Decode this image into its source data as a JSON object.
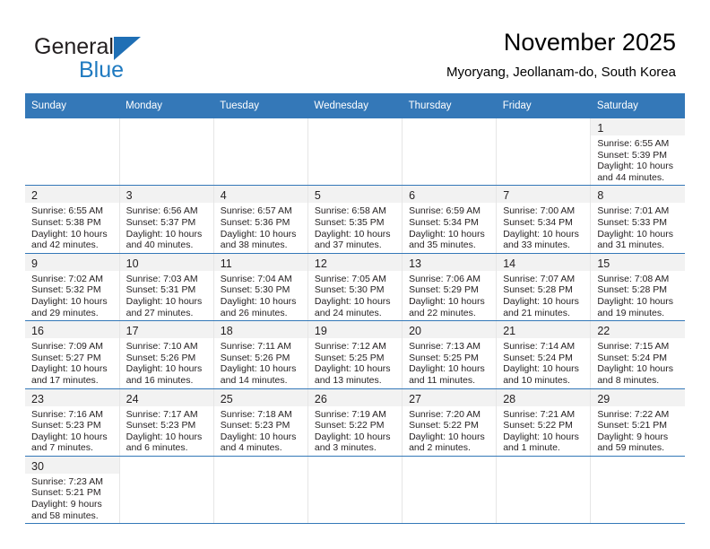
{
  "brand": {
    "name_part1": "General",
    "name_part2": "Blue",
    "triangle_color": "#1f6fb5",
    "blue_color": "#1f7ac0"
  },
  "header": {
    "title": "November 2025",
    "subtitle": "Myoryang, Jeollanam-do, South Korea"
  },
  "theme": {
    "header_row_bg": "#3478b8",
    "daynum_band_bg": "#f2f2f2",
    "row_divider": "#3478b8",
    "cell_divider": "#e6e6e6"
  },
  "weekdays": [
    "Sunday",
    "Monday",
    "Tuesday",
    "Wednesday",
    "Thursday",
    "Friday",
    "Saturday"
  ],
  "weeks": [
    [
      {
        "blank": true
      },
      {
        "blank": true
      },
      {
        "blank": true
      },
      {
        "blank": true
      },
      {
        "blank": true
      },
      {
        "blank": true
      },
      {
        "day": "1",
        "sunrise": "Sunrise: 6:55 AM",
        "sunset": "Sunset: 5:39 PM",
        "daylight1": "Daylight: 10 hours",
        "daylight2": "and 44 minutes."
      }
    ],
    [
      {
        "day": "2",
        "sunrise": "Sunrise: 6:55 AM",
        "sunset": "Sunset: 5:38 PM",
        "daylight1": "Daylight: 10 hours",
        "daylight2": "and 42 minutes."
      },
      {
        "day": "3",
        "sunrise": "Sunrise: 6:56 AM",
        "sunset": "Sunset: 5:37 PM",
        "daylight1": "Daylight: 10 hours",
        "daylight2": "and 40 minutes."
      },
      {
        "day": "4",
        "sunrise": "Sunrise: 6:57 AM",
        "sunset": "Sunset: 5:36 PM",
        "daylight1": "Daylight: 10 hours",
        "daylight2": "and 38 minutes."
      },
      {
        "day": "5",
        "sunrise": "Sunrise: 6:58 AM",
        "sunset": "Sunset: 5:35 PM",
        "daylight1": "Daylight: 10 hours",
        "daylight2": "and 37 minutes."
      },
      {
        "day": "6",
        "sunrise": "Sunrise: 6:59 AM",
        "sunset": "Sunset: 5:34 PM",
        "daylight1": "Daylight: 10 hours",
        "daylight2": "and 35 minutes."
      },
      {
        "day": "7",
        "sunrise": "Sunrise: 7:00 AM",
        "sunset": "Sunset: 5:34 PM",
        "daylight1": "Daylight: 10 hours",
        "daylight2": "and 33 minutes."
      },
      {
        "day": "8",
        "sunrise": "Sunrise: 7:01 AM",
        "sunset": "Sunset: 5:33 PM",
        "daylight1": "Daylight: 10 hours",
        "daylight2": "and 31 minutes."
      }
    ],
    [
      {
        "day": "9",
        "sunrise": "Sunrise: 7:02 AM",
        "sunset": "Sunset: 5:32 PM",
        "daylight1": "Daylight: 10 hours",
        "daylight2": "and 29 minutes."
      },
      {
        "day": "10",
        "sunrise": "Sunrise: 7:03 AM",
        "sunset": "Sunset: 5:31 PM",
        "daylight1": "Daylight: 10 hours",
        "daylight2": "and 27 minutes."
      },
      {
        "day": "11",
        "sunrise": "Sunrise: 7:04 AM",
        "sunset": "Sunset: 5:30 PM",
        "daylight1": "Daylight: 10 hours",
        "daylight2": "and 26 minutes."
      },
      {
        "day": "12",
        "sunrise": "Sunrise: 7:05 AM",
        "sunset": "Sunset: 5:30 PM",
        "daylight1": "Daylight: 10 hours",
        "daylight2": "and 24 minutes."
      },
      {
        "day": "13",
        "sunrise": "Sunrise: 7:06 AM",
        "sunset": "Sunset: 5:29 PM",
        "daylight1": "Daylight: 10 hours",
        "daylight2": "and 22 minutes."
      },
      {
        "day": "14",
        "sunrise": "Sunrise: 7:07 AM",
        "sunset": "Sunset: 5:28 PM",
        "daylight1": "Daylight: 10 hours",
        "daylight2": "and 21 minutes."
      },
      {
        "day": "15",
        "sunrise": "Sunrise: 7:08 AM",
        "sunset": "Sunset: 5:28 PM",
        "daylight1": "Daylight: 10 hours",
        "daylight2": "and 19 minutes."
      }
    ],
    [
      {
        "day": "16",
        "sunrise": "Sunrise: 7:09 AM",
        "sunset": "Sunset: 5:27 PM",
        "daylight1": "Daylight: 10 hours",
        "daylight2": "and 17 minutes."
      },
      {
        "day": "17",
        "sunrise": "Sunrise: 7:10 AM",
        "sunset": "Sunset: 5:26 PM",
        "daylight1": "Daylight: 10 hours",
        "daylight2": "and 16 minutes."
      },
      {
        "day": "18",
        "sunrise": "Sunrise: 7:11 AM",
        "sunset": "Sunset: 5:26 PM",
        "daylight1": "Daylight: 10 hours",
        "daylight2": "and 14 minutes."
      },
      {
        "day": "19",
        "sunrise": "Sunrise: 7:12 AM",
        "sunset": "Sunset: 5:25 PM",
        "daylight1": "Daylight: 10 hours",
        "daylight2": "and 13 minutes."
      },
      {
        "day": "20",
        "sunrise": "Sunrise: 7:13 AM",
        "sunset": "Sunset: 5:25 PM",
        "daylight1": "Daylight: 10 hours",
        "daylight2": "and 11 minutes."
      },
      {
        "day": "21",
        "sunrise": "Sunrise: 7:14 AM",
        "sunset": "Sunset: 5:24 PM",
        "daylight1": "Daylight: 10 hours",
        "daylight2": "and 10 minutes."
      },
      {
        "day": "22",
        "sunrise": "Sunrise: 7:15 AM",
        "sunset": "Sunset: 5:24 PM",
        "daylight1": "Daylight: 10 hours",
        "daylight2": "and 8 minutes."
      }
    ],
    [
      {
        "day": "23",
        "sunrise": "Sunrise: 7:16 AM",
        "sunset": "Sunset: 5:23 PM",
        "daylight1": "Daylight: 10 hours",
        "daylight2": "and 7 minutes."
      },
      {
        "day": "24",
        "sunrise": "Sunrise: 7:17 AM",
        "sunset": "Sunset: 5:23 PM",
        "daylight1": "Daylight: 10 hours",
        "daylight2": "and 6 minutes."
      },
      {
        "day": "25",
        "sunrise": "Sunrise: 7:18 AM",
        "sunset": "Sunset: 5:23 PM",
        "daylight1": "Daylight: 10 hours",
        "daylight2": "and 4 minutes."
      },
      {
        "day": "26",
        "sunrise": "Sunrise: 7:19 AM",
        "sunset": "Sunset: 5:22 PM",
        "daylight1": "Daylight: 10 hours",
        "daylight2": "and 3 minutes."
      },
      {
        "day": "27",
        "sunrise": "Sunrise: 7:20 AM",
        "sunset": "Sunset: 5:22 PM",
        "daylight1": "Daylight: 10 hours",
        "daylight2": "and 2 minutes."
      },
      {
        "day": "28",
        "sunrise": "Sunrise: 7:21 AM",
        "sunset": "Sunset: 5:22 PM",
        "daylight1": "Daylight: 10 hours",
        "daylight2": "and 1 minute."
      },
      {
        "day": "29",
        "sunrise": "Sunrise: 7:22 AM",
        "sunset": "Sunset: 5:21 PM",
        "daylight1": "Daylight: 9 hours",
        "daylight2": "and 59 minutes."
      }
    ],
    [
      {
        "day": "30",
        "sunrise": "Sunrise: 7:23 AM",
        "sunset": "Sunset: 5:21 PM",
        "daylight1": "Daylight: 9 hours",
        "daylight2": "and 58 minutes."
      },
      {
        "blank": true
      },
      {
        "blank": true
      },
      {
        "blank": true
      },
      {
        "blank": true
      },
      {
        "blank": true
      },
      {
        "blank": true
      }
    ]
  ]
}
